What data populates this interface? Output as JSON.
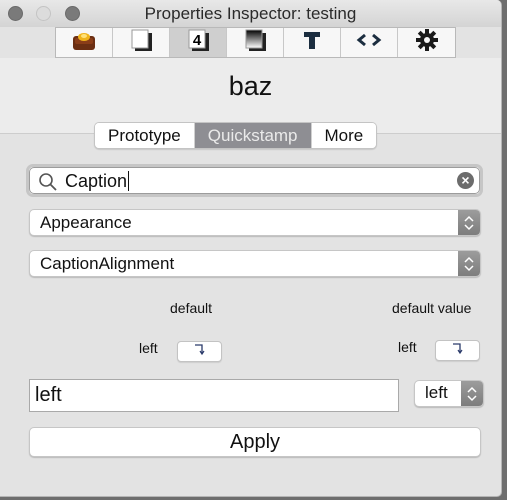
{
  "window": {
    "title": "Properties Inspector: testing"
  },
  "toolbar": {
    "tools": [
      {
        "name": "stack-icon",
        "active": false
      },
      {
        "name": "card-icon",
        "active": false
      },
      {
        "name": "number-icon",
        "glyph": "4",
        "active": true
      },
      {
        "name": "gradient-icon",
        "active": false
      },
      {
        "name": "text-icon",
        "glyph": "T",
        "active": false
      },
      {
        "name": "code-icon",
        "glyph": "<>",
        "active": false
      },
      {
        "name": "gear-icon",
        "glyph": "✱",
        "active": false
      }
    ]
  },
  "object_name": "baz",
  "tabs": [
    {
      "label": "Prototype",
      "active": false
    },
    {
      "label": "Quickstamp",
      "active": true
    },
    {
      "label": "More",
      "active": false
    }
  ],
  "search": {
    "value": "Caption",
    "clear_glyph": "×"
  },
  "category_popup": {
    "selected": "Appearance"
  },
  "property_popup": {
    "selected": "CaptionAlignment"
  },
  "defaults": {
    "default_header": "default",
    "default_value_header": "default value",
    "default_label": "left",
    "default_value_label": "left"
  },
  "value_field": {
    "value": "left"
  },
  "value_popup": {
    "selected": "left"
  },
  "apply_label": "Apply",
  "colors": {
    "active_tab": "#8e8e93",
    "window_bg": "#e3e3e3",
    "stepper": "#8a8a8a"
  }
}
